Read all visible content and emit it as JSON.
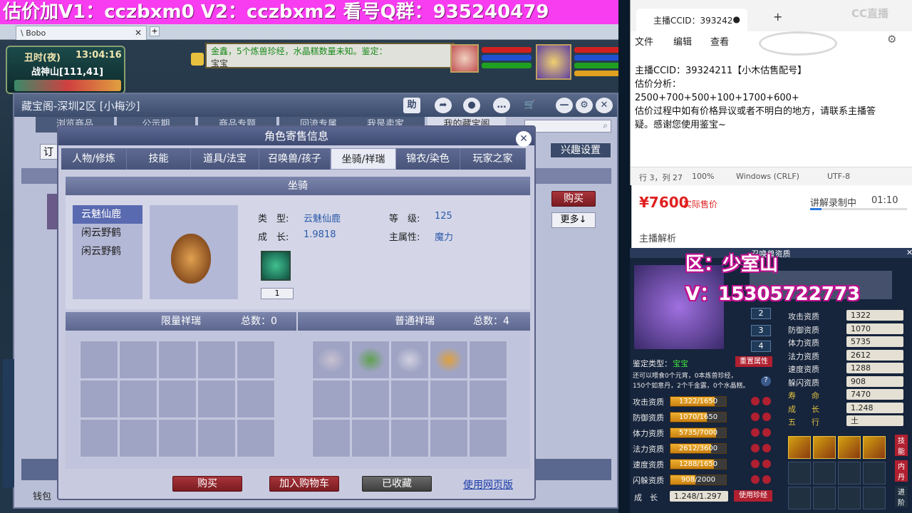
{
  "banner": {
    "text": "估价加V1：cczbxm0     V2：cczbxm2   看号Q群：935240479"
  },
  "browser": {
    "tab_label": "\\ Bobo"
  },
  "game_hud": {
    "time": "丑时(夜)",
    "clock": "13:04:16",
    "location": "战神山[111,41]",
    "chat_line1": "金鑫，5个炼兽珍经，水晶糕数量未知。鉴定：",
    "chat_line2": "宝宝"
  },
  "shop": {
    "title": "藏宝阁-深圳2区 [小梅沙]",
    "tabs": [
      "浏览商品",
      "公示期",
      "商品专题",
      "回流专属",
      "我是卖家",
      "我的藏宝阁"
    ],
    "btn_help": "助",
    "interest_btn": "兴趣设置",
    "buy_btn": "购买",
    "more_btn": "更多↓",
    "left_btn": "订",
    "wallet": "钱包"
  },
  "modal": {
    "title": "角色寄售信息",
    "tabs": [
      "人物/修炼",
      "技能",
      "道具/法宝",
      "召唤兽/孩子",
      "坐骑/祥瑞",
      "锦衣/染色",
      "玩家之家"
    ],
    "section_title": "坐骑",
    "mount_list": [
      "云魅仙鹿",
      "闲云野鹤",
      "闲云野鹤"
    ],
    "type_label": "类　型:",
    "type_value": "云魅仙鹿",
    "level_label": "等　级:",
    "level_value": "125",
    "growth_label": "成　长:",
    "growth_value": "1.9818",
    "main_attr_label": "主属性:",
    "main_attr_value": "魔力",
    "skill_count": "1",
    "limited_title": "限量祥瑞",
    "limited_total": "总数：0",
    "normal_title": "普通祥瑞",
    "normal_total": "总数：4",
    "buy_btn": "购买",
    "cart_btn": "加入购物车",
    "fav_btn": "已收藏",
    "web_link": "使用网页版"
  },
  "notepad": {
    "tab_title": "主播CCID：393242",
    "menu": [
      "文件",
      "编辑",
      "查看"
    ],
    "lines": [
      "主播CCID：39324211【小木估售配号】",
      "估价分析：",
      "2500+700+500+100+1700+600+",
      "估价过程中如有价格异议或者不明白的地方，请联系主播答",
      "疑。感谢您使用鉴宝~"
    ],
    "status_pos": "行 3，列 27",
    "status_zoom": "100%",
    "status_eol": "Windows (CRLF)",
    "status_enc": "UTF-8",
    "watermark": "CC直播"
  },
  "price_panel": {
    "price": "¥7600",
    "price_label": "实际售价",
    "recording": "讲解录制中",
    "time": "01:10",
    "analysis": "主播解析"
  },
  "overlay": {
    "line1": "区：少室山",
    "line2": "V：15305722773"
  },
  "pet": {
    "title": "召唤兽资质",
    "tab_numbers": [
      "2",
      "3",
      "4"
    ],
    "identify_label": "鉴定类型：",
    "identify_value": "宝宝",
    "reset_btn": "重置属性",
    "eat_line1": "还可以喂食0个元宵，0本炼兽珍经，",
    "eat_line2": "150个如意丹，2个千金露，0个水晶糕。",
    "bars": [
      {
        "label": "攻击资质",
        "value": "1322/1650",
        "fill": 0.8
      },
      {
        "label": "防御资质",
        "value": "1070/1650",
        "fill": 0.65
      },
      {
        "label": "体力资质",
        "value": "5735/7000",
        "fill": 0.82
      },
      {
        "label": "法力资质",
        "value": "2612/3600",
        "fill": 0.73
      },
      {
        "label": "速度资质",
        "value": "1288/1650",
        "fill": 0.78
      },
      {
        "label": "闪躲资质",
        "value": "908/2000",
        "fill": 0.45
      }
    ],
    "growth_label": "成　长",
    "growth_value": "1.248/1.297",
    "use_btn": "使用珍经",
    "stats": [
      {
        "label": "攻击资质",
        "value": "1322"
      },
      {
        "label": "防御资质",
        "value": "1070"
      },
      {
        "label": "体力资质",
        "value": "5735"
      },
      {
        "label": "法力资质",
        "value": "2612"
      },
      {
        "label": "速度资质",
        "value": "1288"
      },
      {
        "label": "躲闪资质",
        "value": "908"
      },
      {
        "label": "寿　　命",
        "value": "7470"
      },
      {
        "label": "成　　长",
        "value": "1.248"
      },
      {
        "label": "五　　行",
        "value": "土"
      }
    ],
    "side_btns": [
      "技能",
      "内丹",
      "进阶"
    ]
  }
}
